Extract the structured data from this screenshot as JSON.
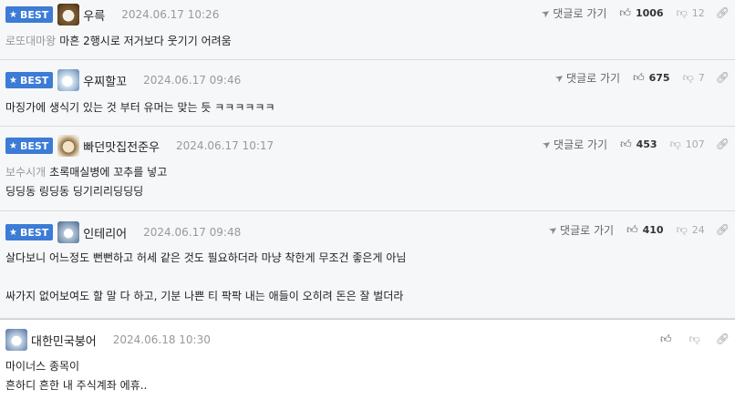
{
  "labels": {
    "best": "BEST",
    "reply": "댓글로 가기"
  },
  "comments": [
    {
      "nick": "우륵",
      "date": "2024.06.17 10:26",
      "up": "1006",
      "down": "12",
      "mention": "로또대마왕",
      "lines": [
        "마흔 2행시로 저거보다 웃기기 어려움"
      ]
    },
    {
      "nick": "우찌할꼬",
      "date": "2024.06.17 09:46",
      "up": "675",
      "down": "7",
      "lines": [
        "마징가에 생식기 있는 것 부터 유머는 맞는 듯 ㅋㅋㅋㅋㅋㅋ"
      ]
    },
    {
      "nick": "빠던맛집전준우",
      "date": "2024.06.17 10:17",
      "up": "453",
      "down": "107",
      "mention": "보수시개",
      "lines": [
        "초록매실병에 꼬추를 넣고",
        "딩딩동 링딩동 딩기리리딩딩딩"
      ]
    },
    {
      "nick": "인테리어",
      "date": "2024.06.17 09:48",
      "up": "410",
      "down": "24",
      "lines": [
        "살다보니 어느정도 뻔뻔하고 허세 같은 것도 필요하더라 마냥 착한게 무조건 좋은게 아님",
        "",
        "싸가지 없어보여도 할 말 다 하고, 기분 나쁜 티 팍팍 내는 애들이 오히려 돈은 잘 벌더라"
      ]
    },
    {
      "nick": "대한민국붕어",
      "date": "2024.06.18 10:30",
      "lines": [
        "마이너스 종목이",
        "흔하디 흔한 내 주식계좌 에휴.."
      ]
    }
  ],
  "icons": {
    "star": "star-icon",
    "reply": "reply-arrow-icon",
    "up": "thumbs-up-icon",
    "down": "thumbs-down-icon",
    "link": "link-icon"
  },
  "colors": {
    "best_badge": "#3c7bd6",
    "best_bg": "#f6f7f9"
  }
}
